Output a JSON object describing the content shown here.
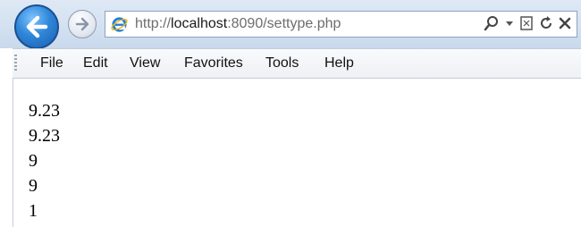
{
  "browser": {
    "url_prefix": "http://",
    "url_host": "localhost",
    "url_rest": ":8090/settype.php",
    "address_tools": [
      "search-icon",
      "dropdown-icon",
      "compat-view-icon",
      "refresh-icon",
      "stop-icon"
    ]
  },
  "menu": {
    "items": [
      "File",
      "Edit",
      "View",
      "Favorites",
      "Tools",
      "Help"
    ]
  },
  "page": {
    "lines": [
      "9.23",
      "9.23",
      "9",
      "9",
      "1"
    ]
  },
  "colors": {
    "back_button": "#2f86d8",
    "chrome_bg": "#d3e1f1",
    "address_border": "#8ea3be"
  }
}
